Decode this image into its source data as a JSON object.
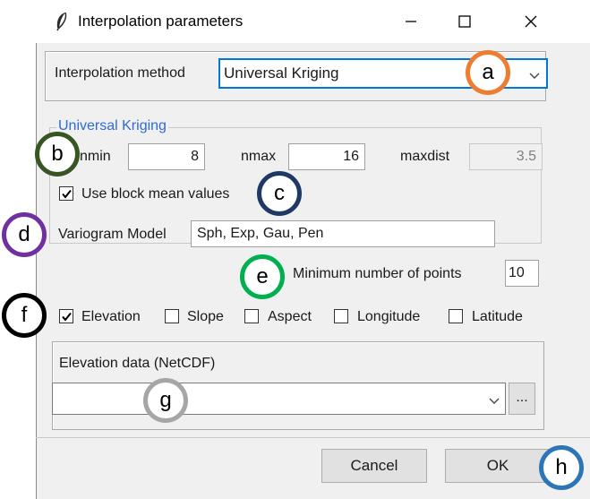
{
  "window": {
    "title": "Interpolation parameters"
  },
  "method": {
    "label": "Interpolation method",
    "value": "Universal Kriging"
  },
  "kriging": {
    "frame_title": "Universal Kriging",
    "nmin_label": "nmin",
    "nmin_value": "8",
    "nmax_label": "nmax",
    "nmax_value": "16",
    "maxdist_label": "maxdist",
    "maxdist_value": "3.5",
    "block_mean_label": "Use block mean values",
    "block_mean_checked": true
  },
  "variogram": {
    "label": "Variogram Model",
    "value": "Sph, Exp, Gau, Pen"
  },
  "min_points": {
    "label": "Minimum number of points",
    "value": "10"
  },
  "covariates": [
    {
      "label": "Elevation",
      "checked": true
    },
    {
      "label": "Slope",
      "checked": false
    },
    {
      "label": "Aspect",
      "checked": false
    },
    {
      "label": "Longitude",
      "checked": false
    },
    {
      "label": "Latitude",
      "checked": false
    }
  ],
  "elevation": {
    "label": "Elevation data (NetCDF)",
    "value": "",
    "browse_label": "..."
  },
  "buttons": {
    "cancel": "Cancel",
    "ok": "OK"
  },
  "annotations": [
    {
      "letter": "a",
      "color": "#ed7d31"
    },
    {
      "letter": "b",
      "color": "#375623"
    },
    {
      "letter": "c",
      "color": "#1f3864"
    },
    {
      "letter": "d",
      "color": "#7030a0"
    },
    {
      "letter": "e",
      "color": "#00b050"
    },
    {
      "letter": "f",
      "color": "#000000"
    },
    {
      "letter": "g",
      "color": "#a6a6a6"
    },
    {
      "letter": "h",
      "color": "#2e75b6"
    }
  ]
}
